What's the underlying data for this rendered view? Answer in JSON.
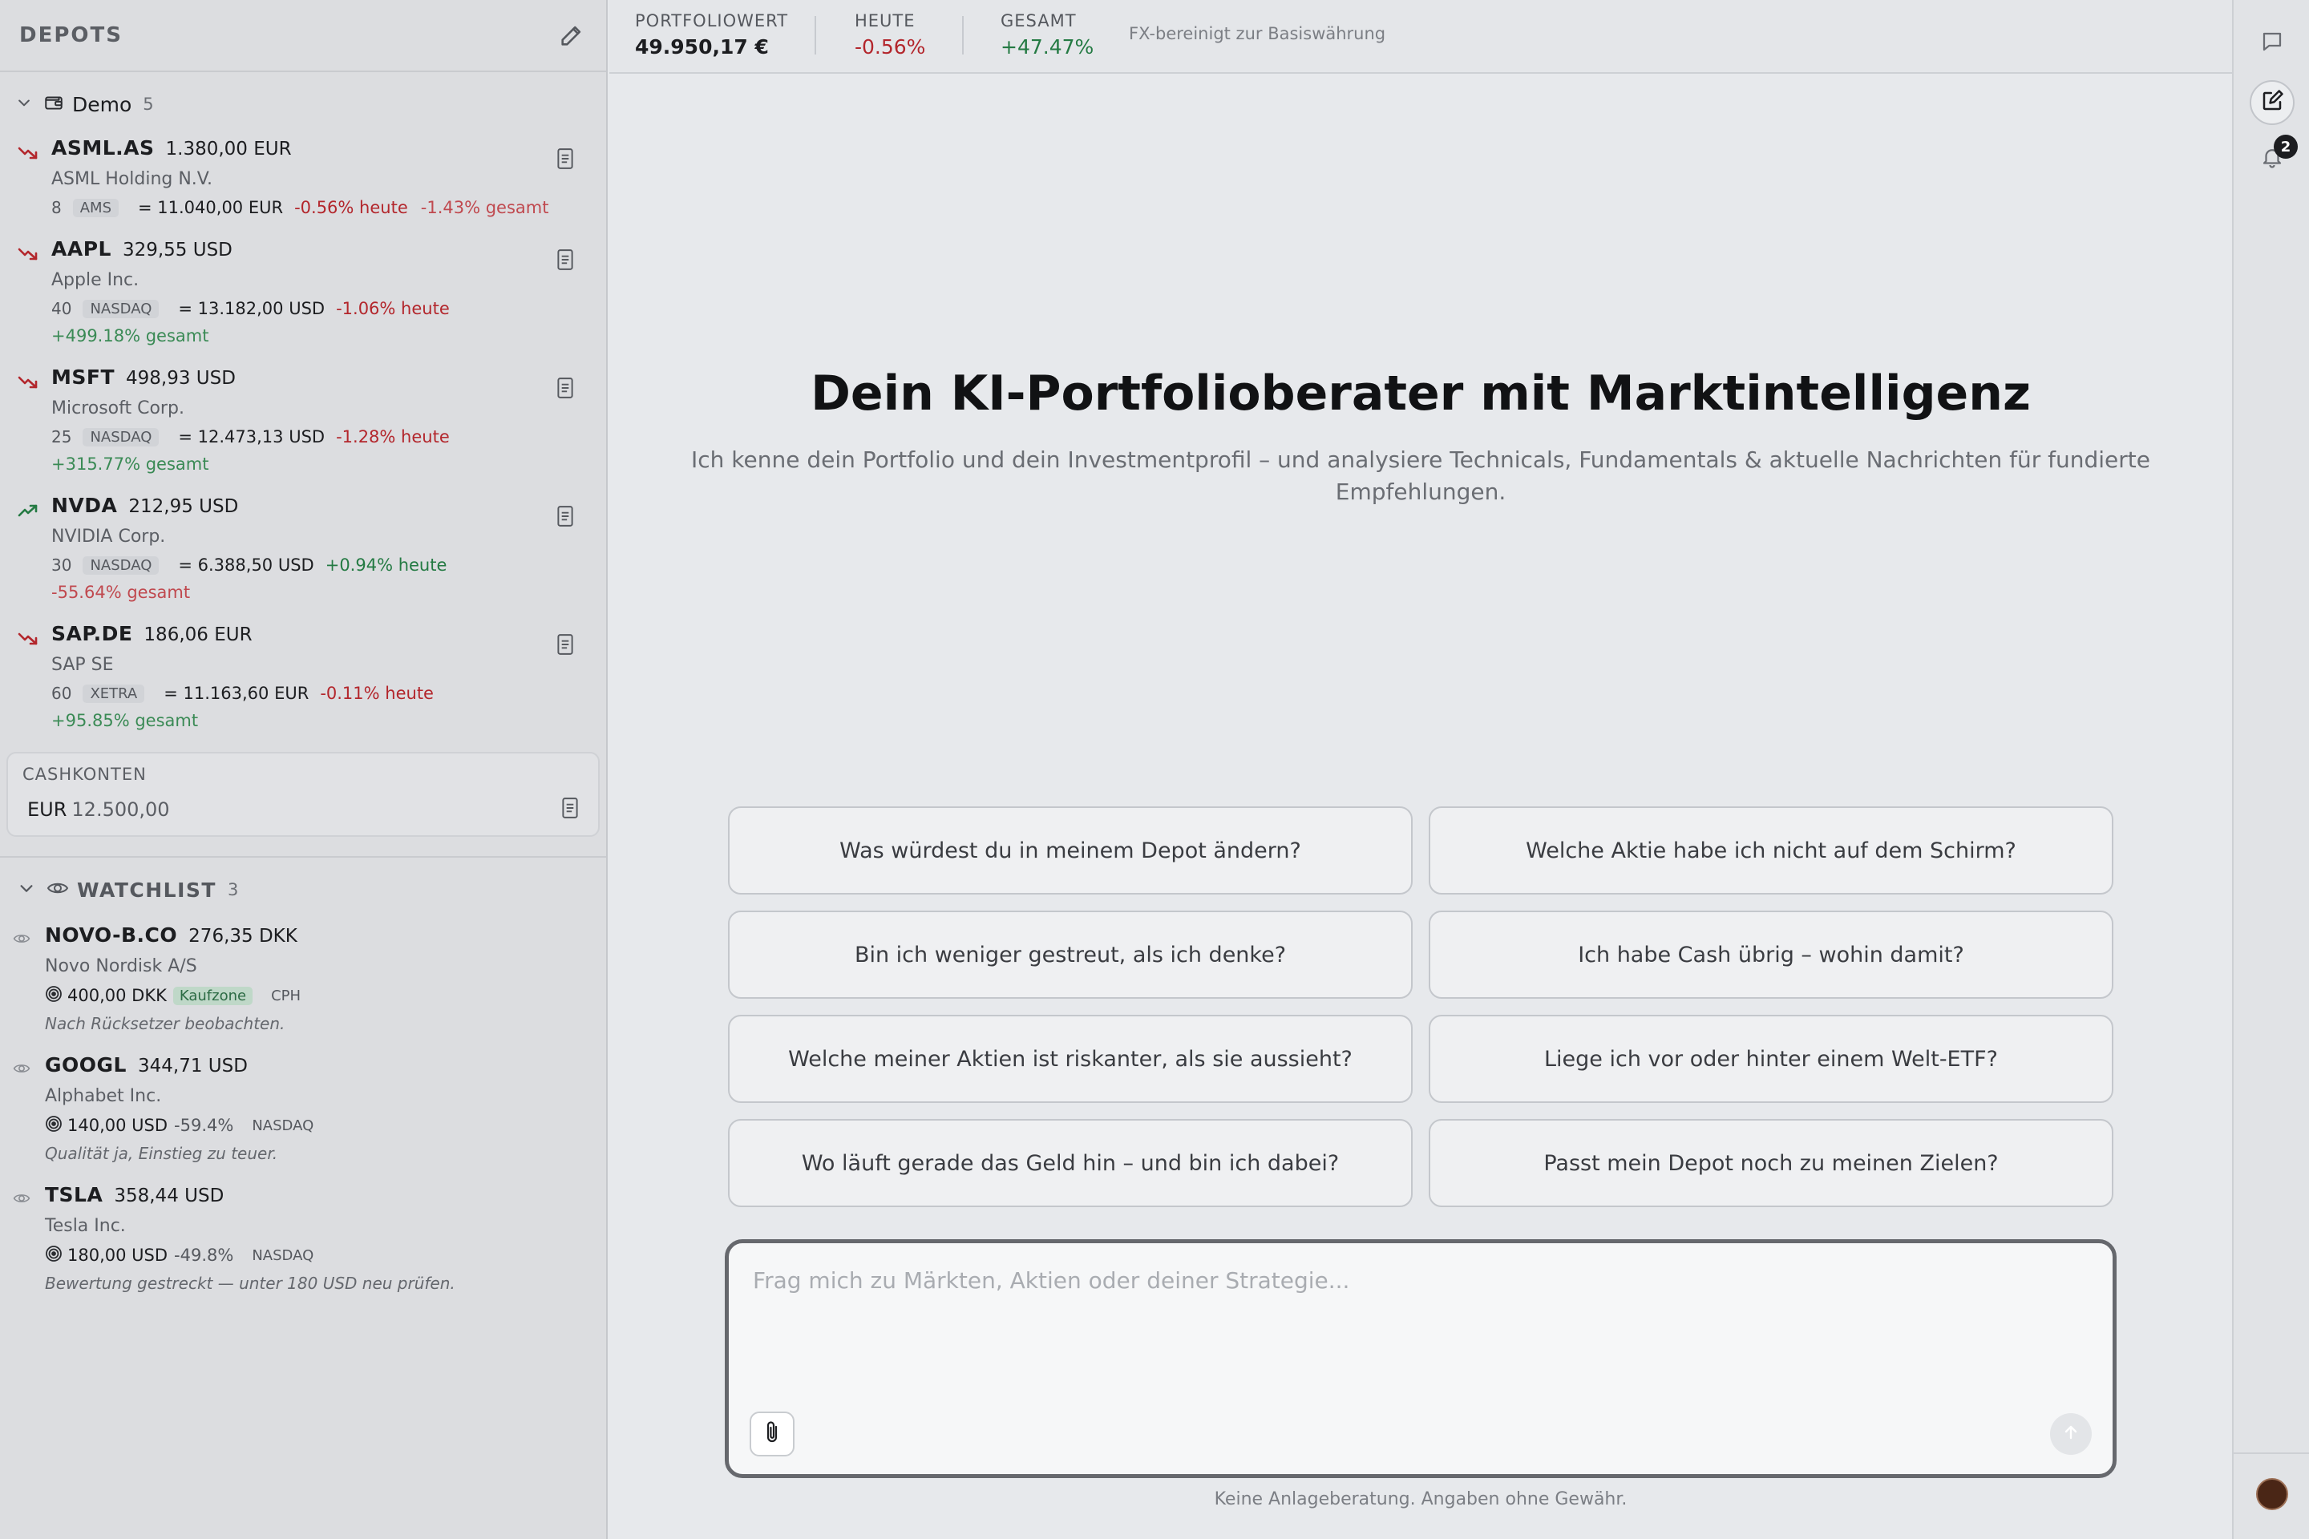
{
  "colors": {
    "negative": "#b3262c",
    "positive": "#247a43",
    "background": "#e7e9ec",
    "sidebar": "#dcdde0"
  },
  "sidebar": {
    "title": "DEPOTS",
    "edit_icon": "pencil-icon",
    "group": {
      "name": "Demo",
      "count": "5"
    },
    "positions": [
      {
        "symbol": "ASML.AS",
        "price": "1.380,00 EUR",
        "name": "ASML Holding N.V.",
        "qty": "8",
        "exchange": "AMS",
        "value": "= 11.040,00 EUR",
        "today": "-0.56% heute",
        "total": "-1.43% gesamt",
        "trend": "down"
      },
      {
        "symbol": "AAPL",
        "price": "329,55 USD",
        "name": "Apple Inc.",
        "qty": "40",
        "exchange": "NASDAQ",
        "value": "= 13.182,00 USD",
        "today": "-1.06% heute",
        "total": "+499.18% gesamt",
        "trend": "down"
      },
      {
        "symbol": "MSFT",
        "price": "498,93 USD",
        "name": "Microsoft Corp.",
        "qty": "25",
        "exchange": "NASDAQ",
        "value": "= 12.473,13 USD",
        "today": "-1.28% heute",
        "total": "+315.77% gesamt",
        "trend": "down"
      },
      {
        "symbol": "NVDA",
        "price": "212,95 USD",
        "name": "NVIDIA Corp.",
        "qty": "30",
        "exchange": "NASDAQ",
        "value": "= 6.388,50 USD",
        "today": "+0.94% heute",
        "total": "-55.64% gesamt",
        "trend": "up"
      },
      {
        "symbol": "SAP.DE",
        "price": "186,06 EUR",
        "name": "SAP SE",
        "qty": "60",
        "exchange": "XETRA",
        "value": "= 11.163,60 EUR",
        "today": "-0.11% heute",
        "total": "+95.85% gesamt",
        "trend": "down"
      }
    ],
    "cash": {
      "title": "CASHKONTEN",
      "currency": "EUR",
      "amount": "12.500,00"
    },
    "watchlist": {
      "title": "WATCHLIST",
      "count": "3",
      "items": [
        {
          "symbol": "NOVO-B.CO",
          "price": "276,35 DKK",
          "name": "Novo Nordisk A/S",
          "target": "400,00 DKK",
          "zone": "Kaufzone",
          "exchange": "CPH",
          "note": "Nach Rücksetzer beobachten."
        },
        {
          "symbol": "GOOGL",
          "price": "344,71 USD",
          "name": "Alphabet Inc.",
          "target": "140,00 USD",
          "distance": "-59.4%",
          "exchange": "NASDAQ",
          "note": "Qualität ja, Einstieg zu teuer."
        },
        {
          "symbol": "TSLA",
          "price": "358,44 USD",
          "name": "Tesla Inc.",
          "target": "180,00 USD",
          "distance": "-49.8%",
          "exchange": "NASDAQ",
          "note": "Bewertung gestreckt — unter 180 USD neu prüfen."
        }
      ]
    }
  },
  "topbar": {
    "portfolio_label": "PORTFOLIOWERT",
    "portfolio_value": "49.950,17 €",
    "today_label": "HEUTE",
    "today_value": "-0.56%",
    "total_label": "GESAMT",
    "total_value": "+47.47%",
    "fx_note": "FX-bereinigt zur Basiswährung"
  },
  "main": {
    "title": "Dein KI-Portfolioberater mit Marktintelligenz",
    "subtitle": "Ich kenne dein Portfolio und dein Investmentprofil – und analysiere Technicals, Fundamentals & aktuelle Nachrichten für fundierte Empfehlungen.",
    "suggestions": [
      "Was würdest du in meinem Depot ändern?",
      "Welche Aktie habe ich nicht auf dem Schirm?",
      "Bin ich weniger gestreut, als ich denke?",
      "Ich habe Cash übrig – wohin damit?",
      "Welche meiner Aktien ist riskanter, als sie aussieht?",
      "Liege ich vor oder hinter einem Welt-ETF?",
      "Wo läuft gerade das Geld hin – und bin ich dabei?",
      "Passt mein Depot noch zu meinen Zielen?"
    ],
    "composer": {
      "placeholder": "Frag mich zu Märkten, Aktien oder deiner Strategie...",
      "value": ""
    },
    "disclaimer": "Keine Anlageberatung. Angaben ohne Gewähr."
  },
  "rail": {
    "notification_count": "2"
  }
}
